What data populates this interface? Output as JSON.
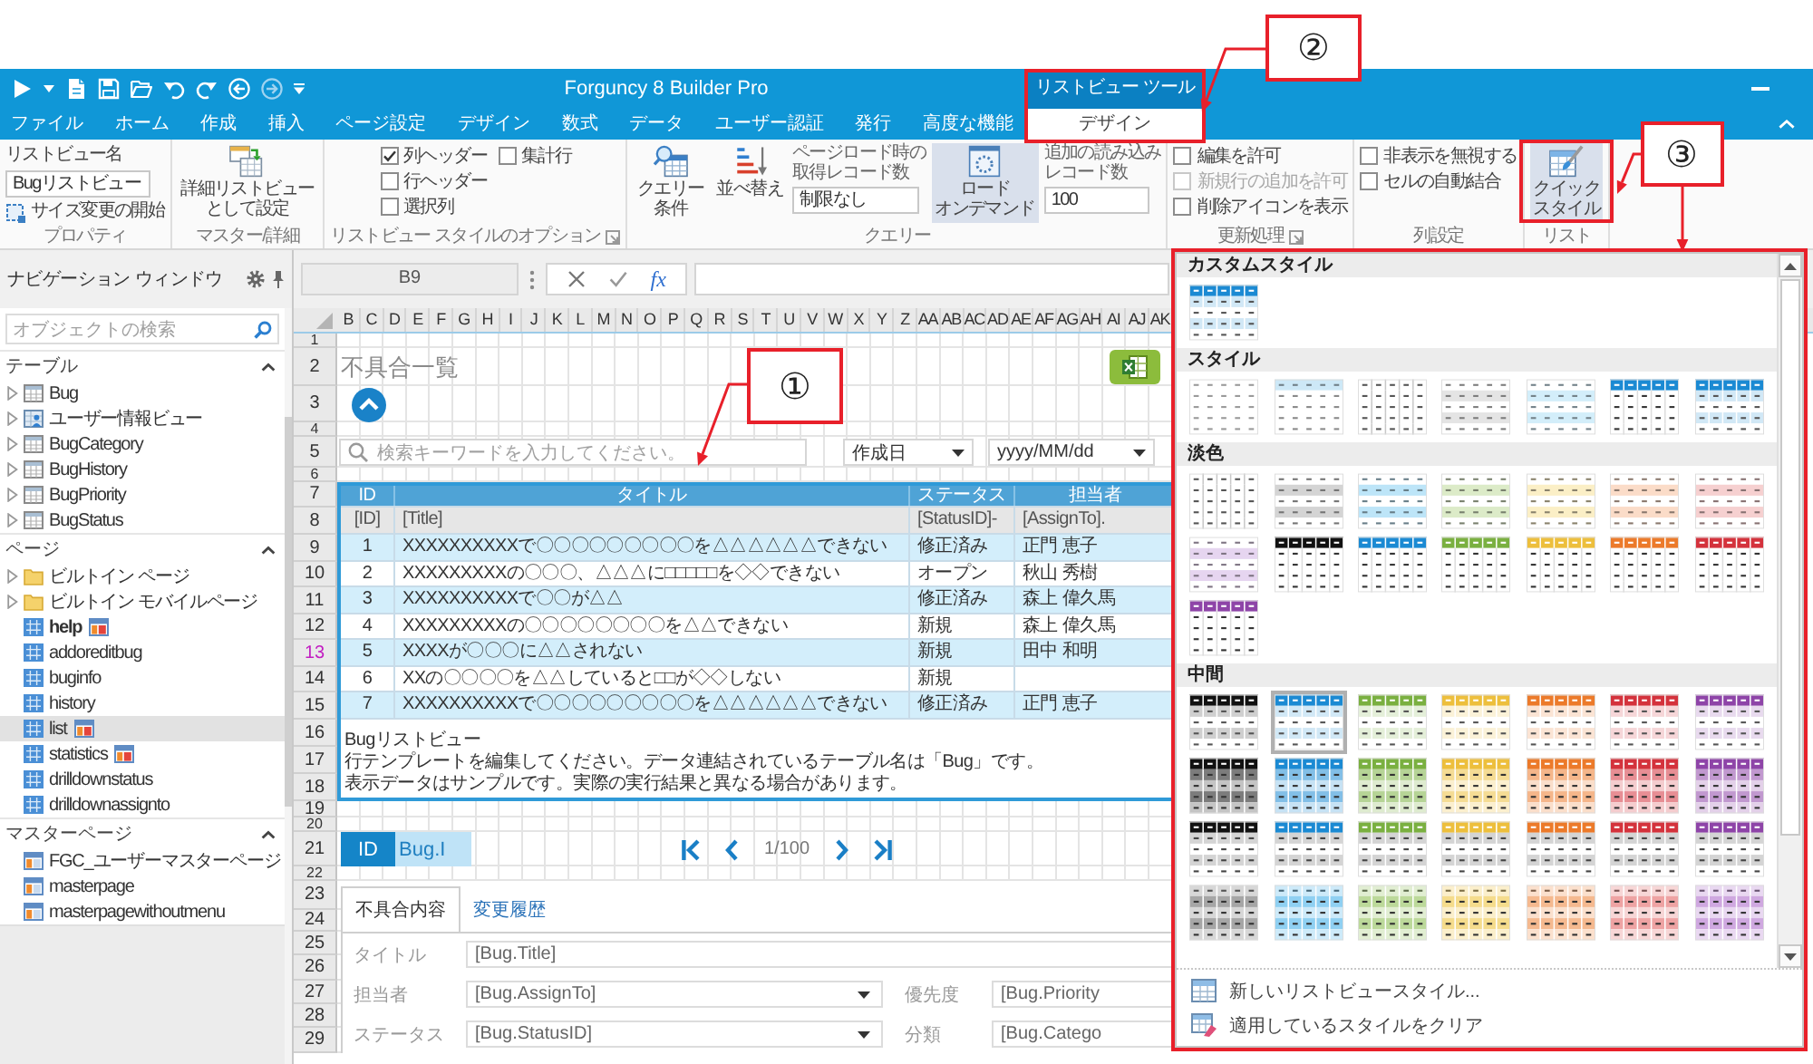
{
  "title_bar": {
    "title": "Forguncy 8 Builder Pro",
    "context_group": "リストビュー ツール"
  },
  "tabs": [
    {
      "label": "ファイル",
      "kind": "main",
      "selected": false
    },
    {
      "label": "ホーム",
      "kind": "main",
      "selected": false
    },
    {
      "label": "作成",
      "kind": "main",
      "selected": false
    },
    {
      "label": "挿入",
      "kind": "main",
      "selected": false
    },
    {
      "label": "ページ設定",
      "kind": "main",
      "selected": false
    },
    {
      "label": "デザイン",
      "kind": "main",
      "selected": false
    },
    {
      "label": "数式",
      "kind": "main",
      "selected": false
    },
    {
      "label": "データ",
      "kind": "main",
      "selected": false
    },
    {
      "label": "ユーザー認証",
      "kind": "main",
      "selected": false
    },
    {
      "label": "発行",
      "kind": "main",
      "selected": false
    },
    {
      "label": "高度な機能",
      "kind": "main",
      "selected": false
    },
    {
      "label": "デザイン",
      "kind": "context",
      "selected": true
    }
  ],
  "ribbon": {
    "properties": {
      "name_label": "リストビュー名",
      "name_value": "Bugリストビュー",
      "resize_button": "サイズ変更の開始",
      "label": "プロパティ"
    },
    "master_detail": {
      "button": [
        "詳細リストビュー",
        "として設定"
      ],
      "label": "マスター/詳細"
    },
    "style_options": {
      "options": [
        {
          "label": "列ヘッダー",
          "checked": true
        },
        {
          "label": "集計行",
          "checked": false
        },
        {
          "label": "行ヘッダー",
          "checked": false
        },
        {
          "label": "選択列",
          "checked": false
        }
      ],
      "label": "リストビュー スタイルのオプション"
    },
    "query": {
      "condition_button": [
        "クエリー",
        "条件"
      ],
      "sort_button": "並べ替え",
      "page_load": {
        "caption": [
          "ページロード時の",
          "取得レコード数"
        ],
        "value": "制限なし"
      },
      "on_demand": {
        "button": [
          "ロード",
          "オンデマンド"
        ],
        "on": true
      },
      "additional": {
        "caption": [
          "追加の読み込み",
          "レコード数"
        ],
        "value": "100"
      },
      "label": "クエリー"
    },
    "update": {
      "options": [
        {
          "label": "編集を許可",
          "checked": false,
          "disabled": false
        },
        {
          "label": "新規行の追加を許可",
          "checked": false,
          "disabled": true
        },
        {
          "label": "削除アイコンを表示",
          "checked": false,
          "disabled": false
        }
      ],
      "label": "更新処理"
    },
    "column_settings": {
      "options": [
        {
          "label": "非表示を無視する",
          "checked": false
        },
        {
          "label": "セルの自動結合",
          "checked": false
        }
      ],
      "label": "列設定"
    },
    "list_style": {
      "button": [
        "クイック",
        "スタイル"
      ],
      "on": true,
      "label": "リスト"
    }
  },
  "navigation": {
    "title": "ナビゲーション ウィンドウ",
    "search": {
      "placeholder": "オブジェクトの検索"
    },
    "sections": [
      {
        "title": "テーブル",
        "expanded": true,
        "items": [
          {
            "label": "Bug",
            "kind": "table",
            "expanded": false,
            "selected": false
          },
          {
            "label": "ユーザー情報ビュー",
            "kind": "view",
            "expanded": false,
            "selected": false
          },
          {
            "label": "BugCategory",
            "kind": "table",
            "expanded": false,
            "selected": false
          },
          {
            "label": "BugHistory",
            "kind": "table",
            "expanded": false,
            "selected": false
          },
          {
            "label": "BugPriority",
            "kind": "table",
            "expanded": false,
            "selected": false
          },
          {
            "label": "BugStatus",
            "kind": "table",
            "expanded": false,
            "selected": false
          }
        ]
      },
      {
        "title": "ページ",
        "expanded": true,
        "items": [
          {
            "label": "ビルトイン ページ",
            "kind": "folder",
            "expanded": false,
            "selected": false
          },
          {
            "label": "ビルトイン モバイルページ",
            "kind": "folder",
            "expanded": false,
            "selected": false
          },
          {
            "label": "help",
            "kind": "page",
            "selected": false,
            "start": true,
            "master_icon": true
          },
          {
            "label": "addoreditbug",
            "kind": "page",
            "selected": false,
            "start": false,
            "master_icon": false
          },
          {
            "label": "buginfo",
            "kind": "page",
            "selected": false,
            "start": false,
            "master_icon": false
          },
          {
            "label": "history",
            "kind": "page",
            "selected": false,
            "start": false,
            "master_icon": false
          },
          {
            "label": "list",
            "kind": "page",
            "selected": true,
            "start": false,
            "master_icon": true
          },
          {
            "label": "statistics",
            "kind": "page",
            "selected": false,
            "start": false,
            "master_icon": true
          },
          {
            "label": "drilldownstatus",
            "kind": "page",
            "selected": false,
            "start": false,
            "master_icon": false
          },
          {
            "label": "drilldownassignto",
            "kind": "page",
            "selected": false,
            "start": false,
            "master_icon": false
          }
        ]
      },
      {
        "title": "マスターページ",
        "expanded": true,
        "items": [
          {
            "label": "FGC_ユーザーマスターページ",
            "kind": "master",
            "selected": false
          },
          {
            "label": "masterpage",
            "kind": "master",
            "selected": false
          },
          {
            "label": "masterpagewithoutmenu",
            "kind": "master",
            "selected": false
          }
        ]
      }
    ]
  },
  "formula_bar": {
    "cell": "B9",
    "function_button": "fx"
  },
  "sheet": {
    "columns": [
      "B",
      "C",
      "D",
      "E",
      "F",
      "G",
      "H",
      "I",
      "J",
      "K",
      "L",
      "M",
      "N",
      "O",
      "P",
      "Q",
      "R",
      "S",
      "T",
      "U",
      "V",
      "W",
      "X",
      "Y",
      "Z",
      "AA",
      "AB",
      "AC",
      "AD",
      "AE",
      "AF",
      "AG",
      "AH",
      "AI",
      "AJ",
      "AK"
    ],
    "rows": [
      {
        "label": "1",
        "highlighted": false
      },
      {
        "label": "2",
        "highlighted": false
      },
      {
        "label": "3",
        "highlighted": false
      },
      {
        "label": "4",
        "highlighted": false
      },
      {
        "label": "5",
        "highlighted": false
      },
      {
        "label": "6",
        "highlighted": false
      },
      {
        "label": "7",
        "highlighted": false
      },
      {
        "label": "8",
        "highlighted": false
      },
      {
        "label": "9",
        "highlighted": false
      },
      {
        "label": "10",
        "highlighted": false
      },
      {
        "label": "11",
        "highlighted": false
      },
      {
        "label": "12",
        "highlighted": false
      },
      {
        "label": "13",
        "highlighted": true
      },
      {
        "label": "14",
        "highlighted": false
      },
      {
        "label": "15",
        "highlighted": false
      },
      {
        "label": "16",
        "highlighted": false
      },
      {
        "label": "17",
        "highlighted": false
      },
      {
        "label": "18",
        "highlighted": false
      },
      {
        "label": "19",
        "highlighted": false
      },
      {
        "label": "20",
        "highlighted": false
      },
      {
        "label": "21",
        "highlighted": false
      },
      {
        "label": "22",
        "highlighted": false
      },
      {
        "label": "23",
        "highlighted": false
      },
      {
        "label": "24",
        "highlighted": false
      },
      {
        "label": "25",
        "highlighted": false
      },
      {
        "label": "26",
        "highlighted": false
      },
      {
        "label": "27",
        "highlighted": false
      },
      {
        "label": "28",
        "highlighted": false
      },
      {
        "label": "29",
        "highlighted": false
      }
    ],
    "page_title": "不具合一覧",
    "search": {
      "placeholder": "検索キーワードを入力してください。"
    },
    "date_filter": {
      "field": "作成日",
      "format": "yyyy/MM/dd"
    },
    "list_view": {
      "columns": [
        "ID",
        "タイトル",
        "ステータス",
        "担当者"
      ],
      "template": [
        "[ID]",
        "[Title]",
        "[StatusID]-",
        "[AssignTo]."
      ],
      "rows": [
        {
          "id": "1",
          "title": "XXXXXXXXXXで〇〇〇〇〇〇〇〇〇を△△△△△△できない",
          "status": "修正済み",
          "assignee": "正門 恵子"
        },
        {
          "id": "2",
          "title": "XXXXXXXXXの〇〇〇、△△△に□□□□□を◇◇できない",
          "status": "オープン",
          "assignee": "秋山 秀樹"
        },
        {
          "id": "3",
          "title": "XXXXXXXXXXで〇〇が△△",
          "status": "修正済み",
          "assignee": "森上 偉久馬"
        },
        {
          "id": "4",
          "title": "XXXXXXXXXの〇〇〇〇〇〇〇〇を△△できない",
          "status": "新規",
          "assignee": "森上 偉久馬"
        },
        {
          "id": "5",
          "title": "XXXXが〇〇〇に△△されない",
          "status": "新規",
          "assignee": "田中 和明"
        },
        {
          "id": "6",
          "title": "XXの〇〇〇〇を△△していると□□が◇◇しない",
          "status": "新規"
        },
        {
          "id": "7",
          "title": "XXXXXXXXXXで〇〇〇〇〇〇〇〇〇を△△△△△△できない",
          "status": "修正済み",
          "assignee": "正門 恵子"
        }
      ],
      "caption": [
        "Bugリストビュー",
        "行テンプレートを編集してください。データ連結されているテーブル名は「Bug」です。",
        "表示データはサンプルです。実際の実行結果と異なる場合があります。"
      ]
    },
    "record": {
      "id_label": "ID",
      "id_value": "Bug.I",
      "page": "1/100"
    },
    "detail_tabs": [
      {
        "label": "不具合内容",
        "selected": true
      },
      {
        "label": "変更履歴",
        "selected": false
      }
    ],
    "form": [
      [
        {
          "label": "タイトル",
          "value": "[Bug.Title]",
          "kind": "text"
        }
      ],
      [
        {
          "label": "担当者",
          "value": "[Bug.AssignTo]",
          "kind": "dropdown"
        },
        {
          "label": "優先度",
          "value": "[Bug.Priority",
          "kind": "text"
        }
      ],
      [
        {
          "label": "ステータス",
          "value": "[Bug.StatusID]",
          "kind": "dropdown"
        },
        {
          "label": "分類",
          "value": "[Bug.Catego",
          "kind": "text"
        }
      ]
    ]
  },
  "gallery": {
    "sections": [
      {
        "title": "カスタムスタイル",
        "styles": [
          {
            "color": "#1b8ad3",
            "kind": "header-banded",
            "selected": false
          }
        ]
      },
      {
        "title": "スタイル",
        "styles": [
          {
            "kind": "plain",
            "selected": false
          },
          {
            "color": "#cde8f7",
            "kind": "tint-header",
            "selected": false
          },
          {
            "kind": "grid",
            "selected": false
          },
          {
            "color": "#e4e4e4",
            "kind": "banded",
            "selected": false
          },
          {
            "color": "#d3eefa",
            "kind": "banded",
            "selected": false
          },
          {
            "color": "#1b8ad3",
            "kind": "header",
            "selected": false
          },
          {
            "color": "#1b8ad3",
            "kind": "header-banded",
            "selected": false
          }
        ]
      },
      {
        "title": "淡色",
        "styles": [
          {
            "kind": "grid",
            "selected": false
          },
          {
            "color": "#d4d4d4",
            "kind": "banded",
            "selected": false
          },
          {
            "color": "#bde5f8",
            "kind": "banded",
            "selected": false
          },
          {
            "color": "#dcebc8",
            "kind": "banded",
            "selected": false
          },
          {
            "color": "#fbefc6",
            "kind": "banded",
            "selected": false
          },
          {
            "color": "#fbdcc8",
            "kind": "banded",
            "selected": false
          },
          {
            "color": "#f6d0d0",
            "kind": "banded",
            "selected": false
          },
          {
            "color": "#e6d5f0",
            "kind": "banded",
            "selected": false
          },
          {
            "color": "#111111",
            "kind": "header",
            "selected": false
          },
          {
            "color": "#1b8ad3",
            "kind": "header",
            "selected": false
          },
          {
            "color": "#7ab040",
            "kind": "header",
            "selected": false
          },
          {
            "color": "#edbf3c",
            "kind": "header",
            "selected": false
          },
          {
            "color": "#ec7a2a",
            "kind": "header",
            "selected": false
          },
          {
            "color": "#d4323c",
            "kind": "header",
            "selected": false
          },
          {
            "color": "#8e44a8",
            "kind": "header",
            "selected": false
          }
        ]
      },
      {
        "title": "中間",
        "styles": [
          {
            "color": "#111111",
            "kind": "header-banded",
            "selected": false
          },
          {
            "color": "#1b8ad3",
            "kind": "header-banded",
            "selected": true
          },
          {
            "color": "#7ab040",
            "kind": "header-banded",
            "selected": false
          },
          {
            "color": "#edbf3c",
            "kind": "header-banded",
            "selected": false
          },
          {
            "color": "#ec7a2a",
            "kind": "header-banded",
            "selected": false
          },
          {
            "color": "#d4323c",
            "kind": "header-banded",
            "selected": false
          },
          {
            "color": "#8e44a8",
            "kind": "header-banded",
            "selected": false
          },
          {
            "color": "#111111",
            "kind": "header-strong",
            "selected": false
          },
          {
            "color": "#1b8ad3",
            "kind": "header-strong",
            "selected": false
          },
          {
            "color": "#7ab040",
            "kind": "header-strong",
            "selected": false
          },
          {
            "color": "#edbf3c",
            "kind": "header-strong",
            "selected": false
          },
          {
            "color": "#ec7a2a",
            "kind": "header-strong",
            "selected": false
          },
          {
            "color": "#d4323c",
            "kind": "header-strong",
            "selected": false
          },
          {
            "color": "#8e44a8",
            "kind": "header-strong",
            "selected": false
          },
          {
            "color": "#111111",
            "kind": "header-gray",
            "selected": false
          },
          {
            "color": "#1b8ad3",
            "kind": "header-gray",
            "selected": false
          },
          {
            "color": "#7ab040",
            "kind": "header-gray",
            "selected": false
          },
          {
            "color": "#edbf3c",
            "kind": "header-gray",
            "selected": false
          },
          {
            "color": "#ec7a2a",
            "kind": "header-gray",
            "selected": false
          },
          {
            "color": "#d4323c",
            "kind": "header-gray",
            "selected": false
          },
          {
            "color": "#8e44a8",
            "kind": "header-gray",
            "selected": false
          },
          {
            "color": "#a6a6a6",
            "kind": "strong-banded",
            "selected": false
          },
          {
            "color": "#8fd0f2",
            "kind": "strong-banded",
            "selected": false
          },
          {
            "color": "#bcd99a",
            "kind": "strong-banded",
            "selected": false
          },
          {
            "color": "#f5dc8c",
            "kind": "strong-banded",
            "selected": false
          },
          {
            "color": "#f5b98f",
            "kind": "strong-banded",
            "selected": false
          },
          {
            "color": "#eea3a3",
            "kind": "strong-banded",
            "selected": false
          },
          {
            "color": "#cfa8e0",
            "kind": "strong-banded",
            "selected": false
          }
        ]
      }
    ],
    "menu": [
      {
        "label": "新しいリストビュースタイル...",
        "kind": "new"
      },
      {
        "label": "適用しているスタイルをクリア",
        "kind": "clear"
      }
    ]
  },
  "callouts": [
    {
      "label": "①"
    },
    {
      "label": "②"
    },
    {
      "label": "③"
    }
  ]
}
